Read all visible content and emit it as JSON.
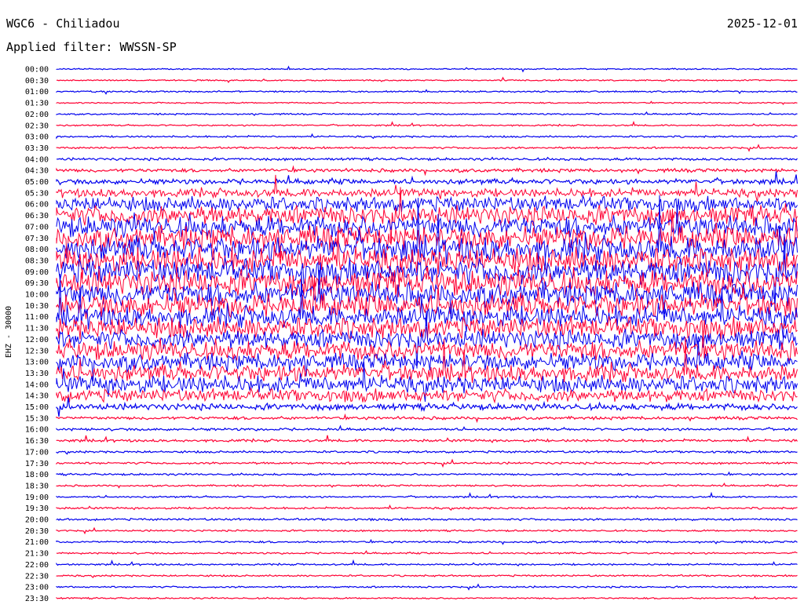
{
  "header": {
    "station": "WGC6 - Chiliadou",
    "date": "2025-12-01",
    "filter": "Applied filter: WWSSN-SP"
  },
  "colors": {
    "blue": "#0000ee",
    "red": "#ff0033",
    "background": "#ffffff"
  },
  "chart_data": {
    "type": "line",
    "ylabel": "EHZ - 30000",
    "row_labels": [
      "00:00",
      "00:30",
      "01:00",
      "01:30",
      "02:00",
      "02:30",
      "03:00",
      "03:30",
      "04:00",
      "04:30",
      "05:00",
      "05:30",
      "06:00",
      "06:30",
      "07:00",
      "07:30",
      "08:00",
      "08:30",
      "09:00",
      "09:30",
      "10:00",
      "10:30",
      "11:00",
      "11:30",
      "12:00",
      "12:30",
      "13:00",
      "13:30",
      "14:00",
      "14:30",
      "15:00",
      "15:30",
      "16:00",
      "16:30",
      "17:00",
      "17:30",
      "18:00",
      "18:30",
      "19:00",
      "19:30",
      "20:00",
      "20:30",
      "21:00",
      "21:30",
      "22:00",
      "22:30",
      "23:00",
      "23:30"
    ],
    "row_colors": [
      "blue",
      "red"
    ],
    "relative_amplitude": [
      0.3,
      0.3,
      0.35,
      0.3,
      0.35,
      0.35,
      0.4,
      0.45,
      0.6,
      0.8,
      1.2,
      2.0,
      3.5,
      4.5,
      5.0,
      5.5,
      6.0,
      6.0,
      6.0,
      6.0,
      5.5,
      5.5,
      5.0,
      5.0,
      4.5,
      4.5,
      4.0,
      4.0,
      4.0,
      3.0,
      1.5,
      0.7,
      0.6,
      0.6,
      0.5,
      0.5,
      0.45,
      0.4,
      0.4,
      0.45,
      0.5,
      0.4,
      0.45,
      0.4,
      0.4,
      0.4,
      0.4,
      0.35
    ],
    "grid": false
  }
}
